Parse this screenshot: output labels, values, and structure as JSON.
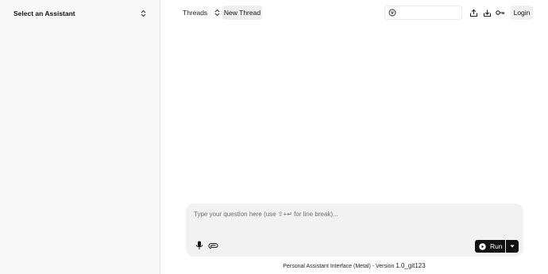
{
  "sidebar": {
    "assistant_select_label": "Select an Assistant"
  },
  "topbar": {
    "threads_label": "Threads",
    "new_thread_label": "New Thread",
    "search_placeholder": "",
    "icons": [
      "search-icon",
      "share-upload-icon",
      "download-icon",
      "key-icon"
    ],
    "login_label": "Login"
  },
  "composer": {
    "placeholder": "Type your question here (use ⇧+↵ for line break)...",
    "run_label": "Run"
  },
  "footer": {
    "text": "Personal Assistant Interface (Metal) - Version ",
    "version": "1.0_git123"
  },
  "colors": {
    "sidebar_bg": "#f8f8f8",
    "composer_bg": "#f2f2f2",
    "run_bg": "#111111"
  }
}
